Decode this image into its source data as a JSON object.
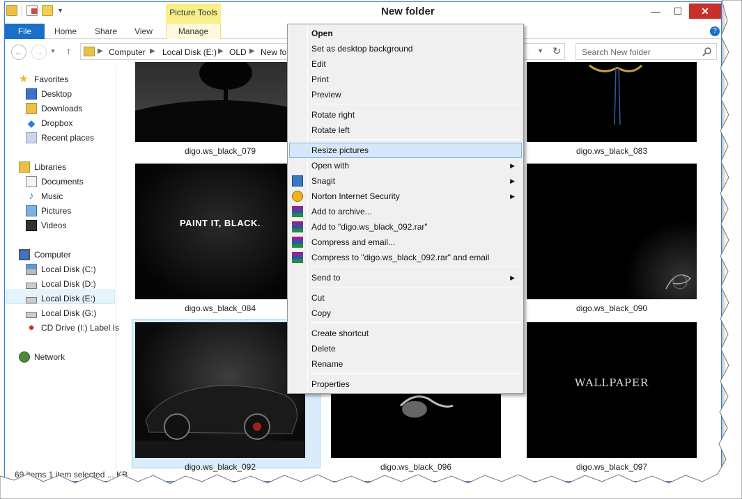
{
  "window": {
    "title": "New folder",
    "contextual_tab_group": "Picture Tools"
  },
  "ribbon": {
    "tabs": [
      "File",
      "Home",
      "Share",
      "View",
      "Manage"
    ]
  },
  "address": {
    "breadcrumbs": [
      "Computer",
      "Local Disk (E:)",
      "OLD",
      "New fo"
    ],
    "search_placeholder": "Search New folder"
  },
  "nav": {
    "favorites": {
      "header": "Favorites",
      "items": [
        "Desktop",
        "Downloads",
        "Dropbox",
        "Recent places"
      ]
    },
    "libraries": {
      "header": "Libraries",
      "items": [
        "Documents",
        "Music",
        "Pictures",
        "Videos"
      ]
    },
    "computer": {
      "header": "Computer",
      "items": [
        "Local Disk (C:)",
        "Local Disk (D:)",
        "Local Disk (E:)",
        "Local Disk (G:)",
        "CD Drive (I:) Label Is"
      ]
    },
    "network": {
      "header": "Network"
    },
    "selected": "Local Disk (E:)"
  },
  "files": {
    "row1": [
      "digo.ws_black_079",
      "digo.ws_black_083"
    ],
    "row2": [
      "digo.ws_black_084",
      "digo.ws_black_090"
    ],
    "row3": [
      "digo.ws_black_092",
      "digo.ws_black_096",
      "digo.ws_black_097"
    ],
    "thumb_text": {
      "paint": "PAINT IT, BLACK.",
      "wallpaper": "WALLPAPER"
    },
    "selected": "digo.ws_black_092"
  },
  "status": {
    "text": "69 items   1 item selected   ... KB"
  },
  "context_menu": {
    "items": {
      "open": "Open",
      "set_bg": "Set as desktop background",
      "edit": "Edit",
      "print": "Print",
      "preview": "Preview",
      "rotate_right": "Rotate right",
      "rotate_left": "Rotate left",
      "resize": "Resize pictures",
      "open_with": "Open with",
      "snagit": "Snagit",
      "norton": "Norton Internet Security",
      "add_archive": "Add to archive...",
      "add_to_rar": "Add to \"digo.ws_black_092.rar\"",
      "compress_email": "Compress and email...",
      "compress_to_rar_email": "Compress to \"digo.ws_black_092.rar\" and email",
      "send_to": "Send to",
      "cut": "Cut",
      "copy": "Copy",
      "create_shortcut": "Create shortcut",
      "delete": "Delete",
      "rename": "Rename",
      "properties": "Properties"
    },
    "highlighted": "Resize pictures"
  },
  "colors": {
    "file_tab": "#1a6fc9",
    "picture_tools": "#f7f08a",
    "selection": "#d9ecfa",
    "close": "#c7312c"
  }
}
